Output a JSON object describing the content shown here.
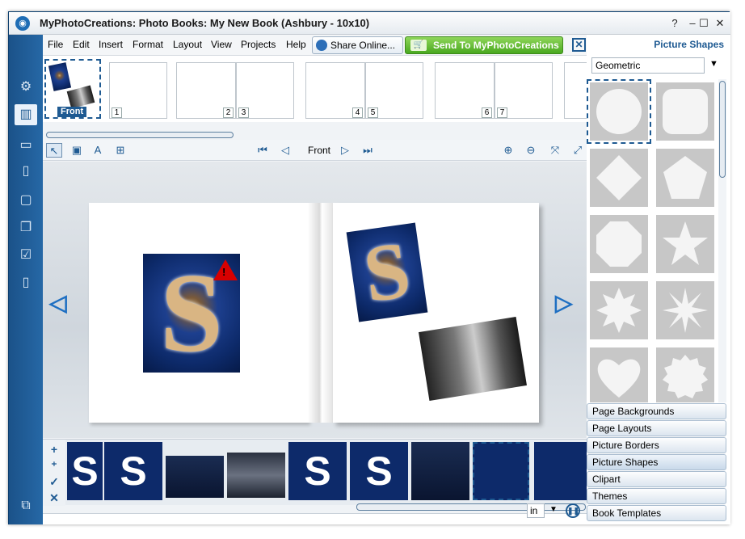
{
  "window": {
    "title": "MyPhotoCreations: Photo Books: My New Book (Ashbury - 10x10)",
    "controls": [
      "?",
      "–",
      "☐",
      "✕"
    ]
  },
  "menu": {
    "items": [
      "File",
      "Edit",
      "Insert",
      "Format",
      "Layout",
      "View",
      "Projects",
      "Help"
    ],
    "share_label": "Share Online...",
    "send_label": "Send To MyPhotoCreations"
  },
  "thumbnails": {
    "front_label": "Front",
    "page_numbers": [
      "1",
      "2",
      "3",
      "4",
      "5",
      "6",
      "7"
    ]
  },
  "page_nav": {
    "label": "Front"
  },
  "right_panel": {
    "title": "Picture Shapes",
    "category": "Geometric",
    "shapes": [
      "circle",
      "rounded-square",
      "diamond",
      "pentagon",
      "octagon",
      "star-5",
      "star-8",
      "star-burst",
      "heart",
      "scalloped"
    ],
    "sections": [
      "Page Backgrounds",
      "Page Layouts",
      "Picture Borders",
      "Picture Shapes",
      "Clipart",
      "Themes",
      "Book Templates"
    ],
    "active_section": "Picture Shapes"
  },
  "filmstrip": {
    "thumb_text": "S"
  },
  "status": {
    "unit": "in"
  },
  "photo": {
    "s_text": "S"
  }
}
